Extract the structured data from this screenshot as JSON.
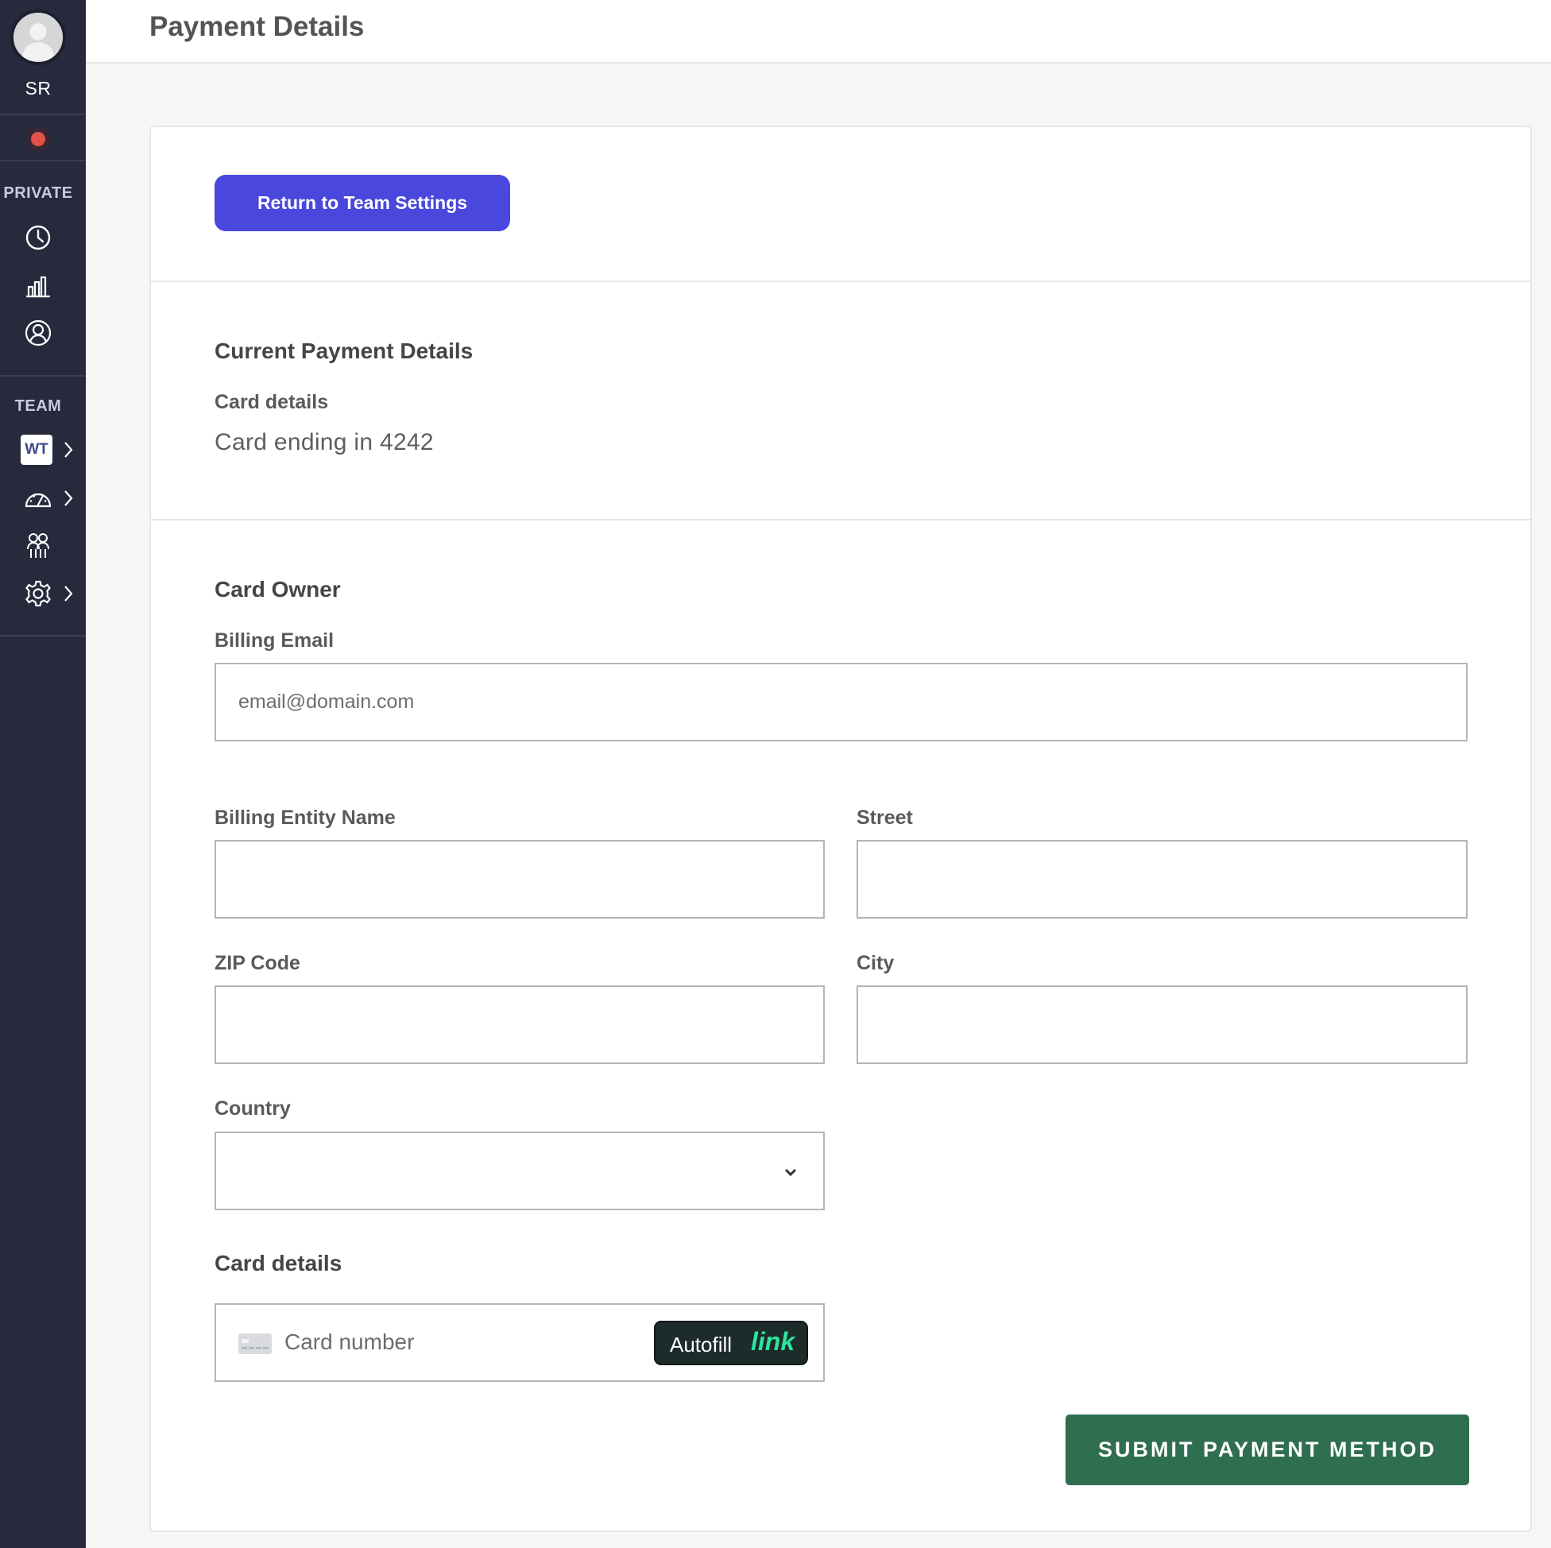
{
  "sidebar": {
    "user_initials": "SR",
    "status_color": "#e2524a",
    "sections": [
      {
        "label": "PRIVATE",
        "icons": [
          "clock-icon",
          "bar-chart-icon",
          "user-circle-icon"
        ]
      },
      {
        "label": "TEAM",
        "icons": [
          "team-badge-WT",
          "dashboard-gauge-icon",
          "people-icon",
          "gear-icon"
        ]
      }
    ],
    "team_badge": "WT"
  },
  "header": {
    "title": "Payment Details"
  },
  "actions": {
    "return_label": "Return to Team Settings",
    "submit_label": "SUBMIT PAYMENT METHOD"
  },
  "current": {
    "heading": "Current Payment Details",
    "card_label": "Card details",
    "card_value": "Card ending in 4242"
  },
  "owner": {
    "heading": "Card Owner",
    "billing_email": {
      "label": "Billing Email",
      "placeholder": "email@domain.com",
      "value": ""
    },
    "entity_name": {
      "label": "Billing Entity Name",
      "value": ""
    },
    "street": {
      "label": "Street",
      "value": ""
    },
    "zip": {
      "label": "ZIP Code",
      "value": ""
    },
    "city": {
      "label": "City",
      "value": ""
    },
    "country": {
      "label": "Country",
      "value": ""
    },
    "card": {
      "label": "Card details",
      "placeholder": "Card number",
      "autofill_text": "Autofill",
      "autofill_brand": "link"
    }
  },
  "colors": {
    "primary": "#4a47dc",
    "submit": "#2f6e4f",
    "sidebar": "#262a3c",
    "link_brand": "#2ee59d"
  }
}
